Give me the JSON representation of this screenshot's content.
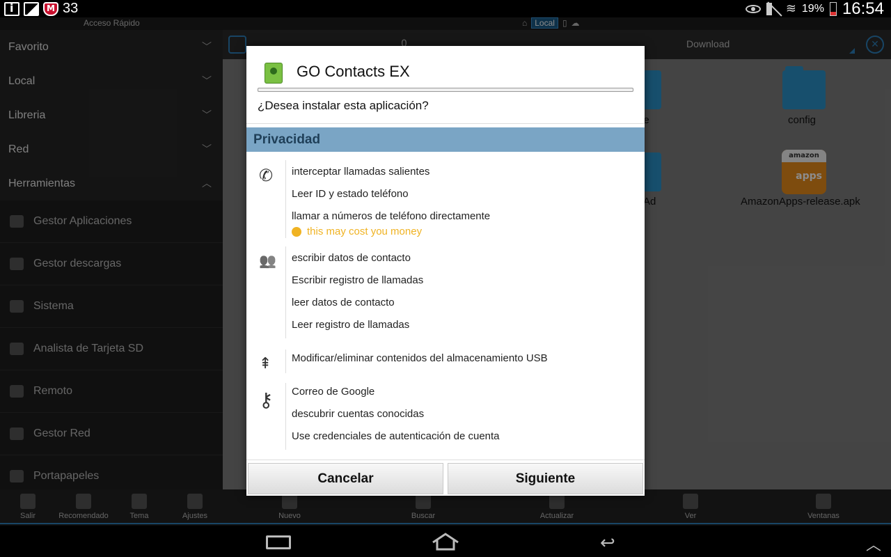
{
  "status_bar": {
    "notification_count": "33",
    "battery_percent": "19%",
    "time": "16:54"
  },
  "top_strip": {
    "quick_access_label": "Acceso Rápido",
    "crumb_local": "Local"
  },
  "sidebar": {
    "sections": [
      {
        "label": "Favorito"
      },
      {
        "label": "Local"
      },
      {
        "label": "Libreria"
      },
      {
        "label": "Red"
      },
      {
        "label": "Herramientas"
      }
    ],
    "tools": [
      {
        "label": "Gestor Aplicaciones"
      },
      {
        "label": "Gestor descargas"
      },
      {
        "label": "Sistema"
      },
      {
        "label": "Analista de Tarjeta SD"
      },
      {
        "label": "Remoto"
      },
      {
        "label": "Gestor Red"
      },
      {
        "label": "Portapapeles"
      }
    ]
  },
  "main": {
    "path_zero": "0",
    "path_folder": "Download",
    "files": [
      {
        "name": "ne"
      },
      {
        "name": "config"
      },
      {
        "name": "Ad"
      },
      {
        "name": "AmazonApps-release.apk"
      }
    ],
    "apk_brand": "amazon",
    "apk_text": "apps"
  },
  "toolbar": {
    "left": [
      {
        "label": "Salir"
      },
      {
        "label": "Recomendado"
      },
      {
        "label": "Tema"
      },
      {
        "label": "Ajustes"
      }
    ],
    "right": [
      {
        "label": "Nuevo"
      },
      {
        "label": "Buscar"
      },
      {
        "label": "Actualizar"
      },
      {
        "label": "Ver"
      },
      {
        "label": "Ventanas"
      }
    ]
  },
  "dialog": {
    "app_name": "GO Contacts EX",
    "question": "¿Desea instalar esta aplicación?",
    "section": "Privacidad",
    "groups": [
      {
        "icon": "phone-icon",
        "items": [
          "interceptar llamadas salientes",
          "Leer ID y estado teléfono",
          "llamar a números de teléfono directamente"
        ],
        "warning": "this may cost you money"
      },
      {
        "icon": "contacts-icon",
        "items": [
          "escribir datos de contacto",
          "Escribir registro de llamadas",
          "leer datos de contacto",
          "Leer registro de llamadas"
        ]
      },
      {
        "icon": "usb-icon",
        "items": [
          "Modificar/eliminar contenidos del almacenamiento USB"
        ]
      },
      {
        "icon": "key-icon",
        "items": [
          "Correo de Google",
          "descubrir cuentas conocidas",
          "Use credenciales de autenticación de cuenta"
        ]
      }
    ],
    "cancel_label": "Cancelar",
    "next_label": "Siguiente"
  },
  "colors": {
    "accent": "#2c7fb8",
    "section_bar": "#7aa5c5",
    "warning": "#f0b323"
  }
}
